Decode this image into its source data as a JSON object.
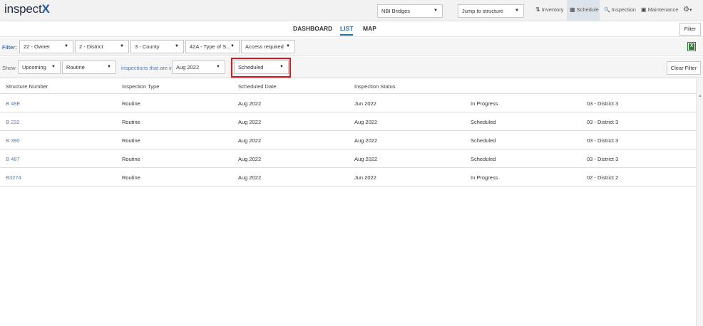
{
  "app": {
    "logo_text": "inspect",
    "logo_mark": "X"
  },
  "topbar": {
    "network_select": "NBI Bridges",
    "jump_select": "Jump to structure",
    "nav": [
      {
        "icon": "sort-icon",
        "glyph": "⇅",
        "label": "Inventory"
      },
      {
        "icon": "calendar-icon",
        "glyph": "▦",
        "label": "Schedule",
        "active": true
      },
      {
        "icon": "search-icon",
        "glyph": "🔍",
        "label": "Inspection"
      },
      {
        "icon": "briefcase-icon",
        "glyph": "▣",
        "label": "Maintenance"
      }
    ],
    "settings_glyph": "⚙",
    "settings_caret": "▾"
  },
  "views": {
    "tabs": [
      "DASHBOARD",
      "LIST",
      "MAP"
    ],
    "active": "LIST",
    "filter_button": "Filter"
  },
  "filters": {
    "label": "Filter:",
    "selects": [
      "22 - Owner",
      "2 - District",
      "3 - County",
      "42A - Type of S...",
      "Access required"
    ]
  },
  "show": {
    "label": "Show",
    "timing": "Upcoming",
    "type": "Routine",
    "inspections_label": "inspections that are in:",
    "month": "Aug 2022",
    "status": "Scheduled",
    "clear_button": "Clear Filter"
  },
  "table": {
    "headers": [
      "Structure Number",
      "Inspection Type",
      "Scheduled Date",
      "Inspection Status"
    ],
    "rows": [
      [
        "B 48E",
        "Routine",
        "Aug 2022",
        "Jun 2022",
        "In Progress",
        "03 - District 3"
      ],
      [
        "B 232",
        "Routine",
        "Aug 2022",
        "Aug 2022",
        "Scheduled",
        "03 - District 3"
      ],
      [
        "B 390",
        "Routine",
        "Aug 2022",
        "Aug 2022",
        "Scheduled",
        "03 - District 3"
      ],
      [
        "B 487",
        "Routine",
        "Aug 2022",
        "Aug 2022",
        "Scheduled",
        "03 - District 3"
      ],
      [
        "B3274",
        "Routine",
        "Aug 2022",
        "Jun 2022",
        "In Progress",
        "02 - District 2"
      ]
    ]
  },
  "colors": {
    "accent": "#1f6fb2",
    "highlight": "#e0141e",
    "excel": "#2e7d32"
  }
}
